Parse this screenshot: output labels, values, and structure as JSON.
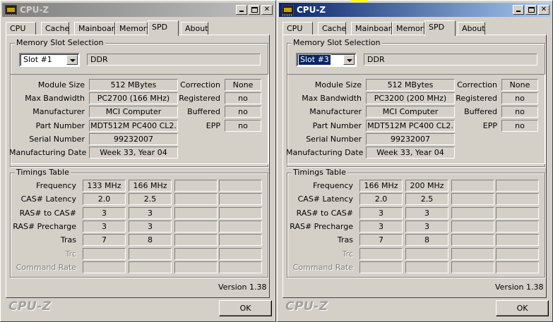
{
  "windows": [
    {
      "id": "left",
      "title": "CPU-Z",
      "active": false,
      "tabs": [
        "CPU",
        "Cache",
        "Mainboard",
        "Memory",
        "SPD",
        "About"
      ],
      "selected_tab": "SPD",
      "slot_group_label": "Memory Slot Selection",
      "slot_value": "Slot #1",
      "memory_type": "DDR",
      "labels": {
        "module_size": "Module Size",
        "max_bandwidth": "Max Bandwidth",
        "manufacturer": "Manufacturer",
        "part_number": "Part Number",
        "serial_number": "Serial Number",
        "manufacturing_date": "Manufacturing Date",
        "correction": "Correction",
        "registered": "Registered",
        "buffered": "Buffered",
        "epp": "EPP"
      },
      "module": {
        "module_size": "512 MBytes",
        "max_bandwidth": "PC2700 (166 MHz)",
        "manufacturer": "MCI Computer",
        "part_number": "MDT512M PC400 CL2.",
        "serial_number": "99232007",
        "manufacturing_date": "Week 33, Year 04",
        "correction": "None",
        "registered": "no",
        "buffered": "no",
        "epp": "no"
      },
      "timings_label": "Timings Table",
      "timings": [
        {
          "label": "Frequency",
          "values": [
            "133 MHz",
            "166 MHz",
            "",
            ""
          ],
          "disabled": false
        },
        {
          "label": "CAS# Latency",
          "values": [
            "2.0",
            "2.5",
            "",
            ""
          ],
          "disabled": false
        },
        {
          "label": "RAS# to CAS#",
          "values": [
            "3",
            "3",
            "",
            ""
          ],
          "disabled": false
        },
        {
          "label": "RAS# Precharge",
          "values": [
            "3",
            "3",
            "",
            ""
          ],
          "disabled": false
        },
        {
          "label": "Tras",
          "values": [
            "7",
            "8",
            "",
            ""
          ],
          "disabled": false
        },
        {
          "label": "Trc",
          "values": [
            "",
            "",
            "",
            ""
          ],
          "disabled": true
        },
        {
          "label": "Command Rate",
          "values": [
            "",
            "",
            "",
            ""
          ],
          "disabled": true
        }
      ],
      "version": "Version 1.38",
      "logo": "CPU-Z",
      "ok_label": "OK"
    },
    {
      "id": "right",
      "title": "CPU-Z",
      "active": true,
      "tabs": [
        "CPU",
        "Cache",
        "Mainboard",
        "Memory",
        "SPD",
        "About"
      ],
      "selected_tab": "SPD",
      "slot_group_label": "Memory Slot Selection",
      "slot_value": "Slot #3",
      "memory_type": "DDR",
      "labels": {
        "module_size": "Module Size",
        "max_bandwidth": "Max Bandwidth",
        "manufacturer": "Manufacturer",
        "part_number": "Part Number",
        "serial_number": "Serial Number",
        "manufacturing_date": "Manufacturing Date",
        "correction": "Correction",
        "registered": "Registered",
        "buffered": "Buffered",
        "epp": "EPP"
      },
      "module": {
        "module_size": "512 MBytes",
        "max_bandwidth": "PC3200 (200 MHz)",
        "manufacturer": "MCI Computer",
        "part_number": "MDT512M PC400 CL2.",
        "serial_number": "99232007",
        "manufacturing_date": "Week 33, Year 04",
        "correction": "None",
        "registered": "no",
        "buffered": "no",
        "epp": "no"
      },
      "timings_label": "Timings Table",
      "timings": [
        {
          "label": "Frequency",
          "values": [
            "166 MHz",
            "200 MHz",
            "",
            ""
          ],
          "disabled": false
        },
        {
          "label": "CAS# Latency",
          "values": [
            "2.0",
            "2.5",
            "",
            ""
          ],
          "disabled": false
        },
        {
          "label": "RAS# to CAS#",
          "values": [
            "3",
            "3",
            "",
            ""
          ],
          "disabled": false
        },
        {
          "label": "RAS# Precharge",
          "values": [
            "3",
            "3",
            "",
            ""
          ],
          "disabled": false
        },
        {
          "label": "Tras",
          "values": [
            "7",
            "8",
            "",
            ""
          ],
          "disabled": false
        },
        {
          "label": "Trc",
          "values": [
            "",
            "",
            "",
            ""
          ],
          "disabled": true
        },
        {
          "label": "Command Rate",
          "values": [
            "",
            "",
            "",
            ""
          ],
          "disabled": true
        }
      ],
      "version": "Version 1.38",
      "logo": "CPU-Z",
      "ok_label": "OK"
    }
  ]
}
